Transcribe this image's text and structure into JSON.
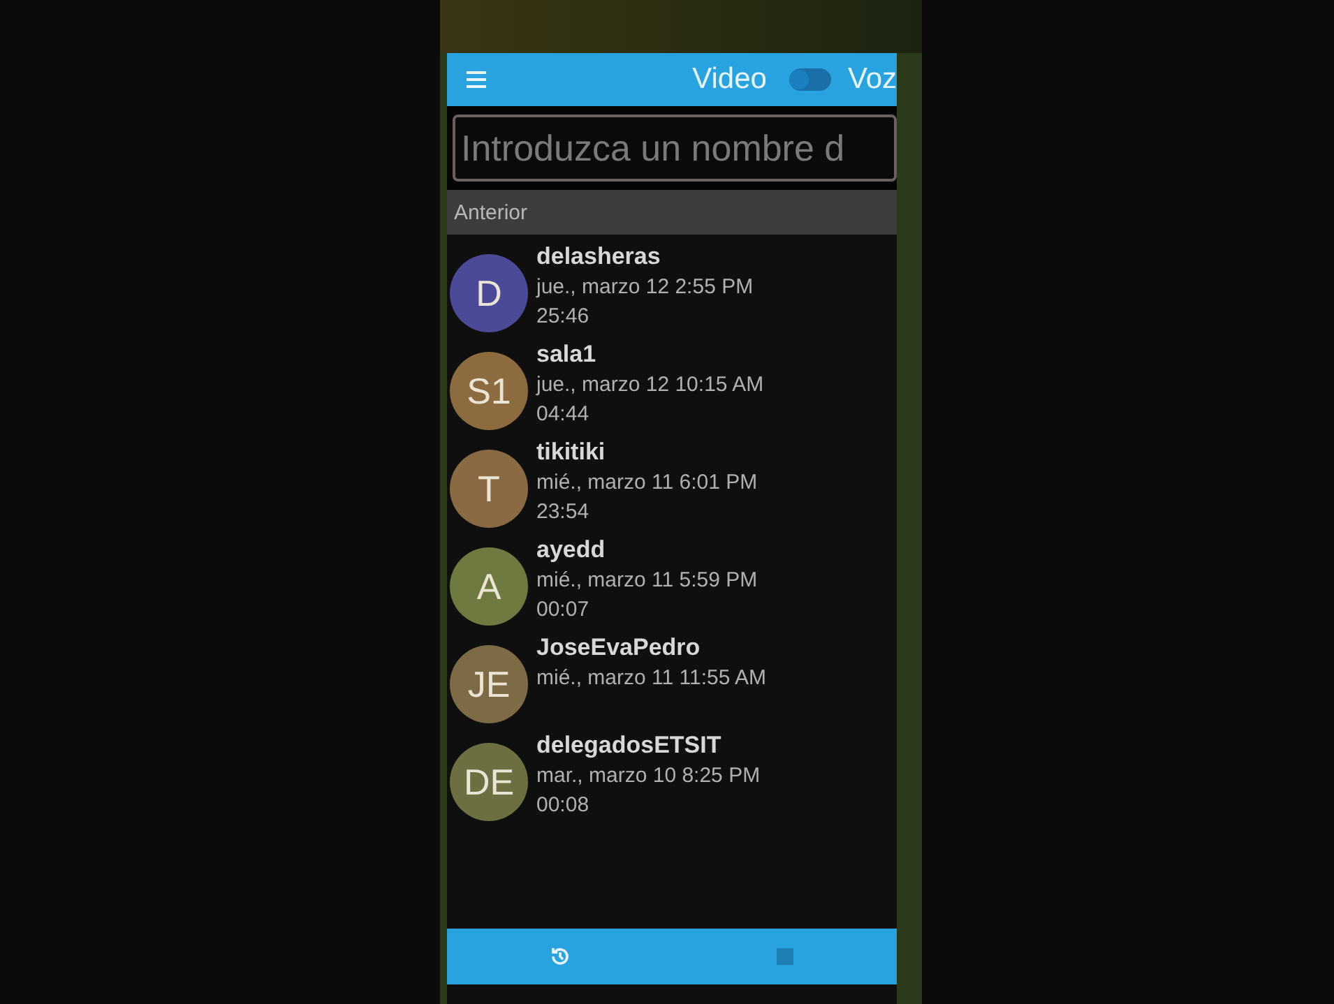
{
  "app_bar": {
    "title": "Video",
    "switch": {
      "on": false
    },
    "other_label": "Voz"
  },
  "search": {
    "placeholder": "Introduzca un nombre d"
  },
  "section": {
    "title": "Anterior"
  },
  "calls": [
    {
      "initials": "D",
      "color": "#4b4a99",
      "name": "delasheras",
      "date": "jue., marzo 12 2:55 PM",
      "duration": "25:46"
    },
    {
      "initials": "S1",
      "color": "#8c6b3f",
      "name": "sala1",
      "date": "jue., marzo 12 10:15 AM",
      "duration": "04:44"
    },
    {
      "initials": "T",
      "color": "#8a6a42",
      "name": "tikitiki",
      "date": "mié., marzo 11 6:01 PM",
      "duration": "23:54"
    },
    {
      "initials": "A",
      "color": "#6e7a3f",
      "name": "ayedd",
      "date": "mié., marzo 11 5:59 PM",
      "duration": "00:07"
    },
    {
      "initials": "JE",
      "color": "#7c6b45",
      "name": "JoseEvaPedro",
      "date": "mié., marzo 11 11:55 AM"
    },
    {
      "initials": "DE",
      "color": "#6d6f40",
      "name": "delegadosETSIT",
      "date": "mar., marzo 10 8:25 PM",
      "duration": "00:08"
    }
  ],
  "bottom_nav": [
    {
      "kind": "history",
      "selected": true
    },
    {
      "kind": "square",
      "selected": false
    }
  ]
}
